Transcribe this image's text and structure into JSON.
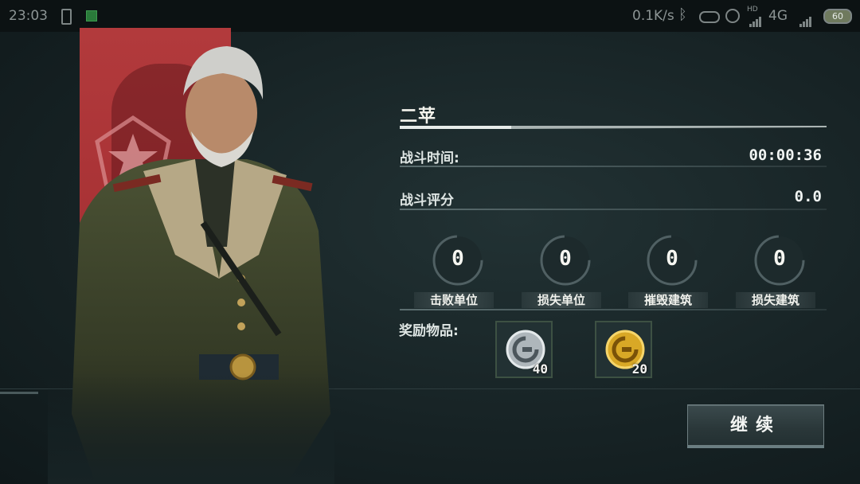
{
  "status_bar": {
    "time": "23:03",
    "net_speed": "0.1K/s",
    "hd_label": "HD",
    "network": "4G",
    "battery": "60"
  },
  "result": {
    "stage_name": "二苹",
    "battle_time_label": "战斗时间:",
    "battle_time_value": "00:00:36",
    "battle_score_label": "战斗评分",
    "battle_score_value": "0.0",
    "stats": [
      {
        "label": "击败单位",
        "value": "0"
      },
      {
        "label": "损失单位",
        "value": "0"
      },
      {
        "label": "摧毁建筑",
        "value": "0"
      },
      {
        "label": "损失建筑",
        "value": "0"
      }
    ],
    "rewards_label": "奖励物品:",
    "rewards": [
      {
        "icon": "silver-coin-icon",
        "count": "40"
      },
      {
        "icon": "gold-coin-icon",
        "count": "20"
      }
    ]
  },
  "continue_button": "继续",
  "colors": {
    "banner_red": "#a83235",
    "background": "#1b2a2c",
    "reward_border": "#3d5143"
  }
}
